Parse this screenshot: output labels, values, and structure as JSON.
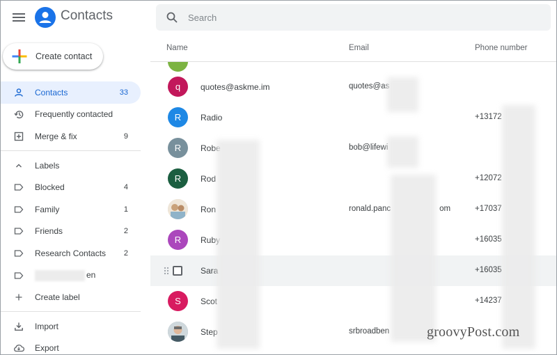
{
  "app": {
    "title": "Contacts"
  },
  "sidebar": {
    "create_label": "Create contact",
    "items": [
      {
        "label": "Contacts",
        "count": "33",
        "icon": "person-icon",
        "active": true
      },
      {
        "label": "Frequently contacted",
        "count": "",
        "icon": "history-icon"
      },
      {
        "label": "Merge & fix",
        "count": "9",
        "icon": "merge-icon"
      }
    ],
    "labels_header": "Labels",
    "labels": [
      {
        "label": "Blocked",
        "count": "4"
      },
      {
        "label": "Family",
        "count": "1"
      },
      {
        "label": "Friends",
        "count": "2"
      },
      {
        "label": "Research Contacts",
        "count": "2"
      },
      {
        "label": "en",
        "count": ""
      }
    ],
    "create_label_link": "Create label",
    "import_label": "Import",
    "export_label": "Export"
  },
  "search": {
    "placeholder": "Search"
  },
  "table": {
    "headers": {
      "name": "Name",
      "email": "Email",
      "phone": "Phone number"
    },
    "rows": [
      {
        "initial": "",
        "name": "",
        "email": "",
        "phone": "",
        "color": "#7cb342"
      },
      {
        "initial": "q",
        "name": "quotes@askme.im",
        "email": "quotes@as",
        "phone": "",
        "color": "#c2185b"
      },
      {
        "initial": "R",
        "name": "Radio",
        "email": "",
        "phone": "+13172",
        "color": "#1e88e5"
      },
      {
        "initial": "R",
        "name": "Robe",
        "email": "bob@lifewi",
        "phone": "",
        "color": "#78909c"
      },
      {
        "initial": "R",
        "name": "Rod",
        "email": "",
        "phone": "+12072",
        "color": "#1b5e40"
      },
      {
        "initial": "",
        "name": "Ron",
        "email": "ronald.panc",
        "email_tail": "om",
        "phone": "+17037",
        "color": "#d7ccc8"
      },
      {
        "initial": "R",
        "name": "Ruby",
        "email": "",
        "phone": "+16035",
        "color": "#ab47bc"
      },
      {
        "initial": "",
        "name": "Sara",
        "email": "",
        "phone": "+16035",
        "color": ""
      },
      {
        "initial": "S",
        "name": "Scot",
        "email": "",
        "phone": "+14237",
        "color": "#d81b60"
      },
      {
        "initial": "",
        "name": "Step",
        "email": "srbroadben",
        "phone": "",
        "color": "#90a4ae"
      }
    ]
  },
  "watermark": "groovyPost.com"
}
